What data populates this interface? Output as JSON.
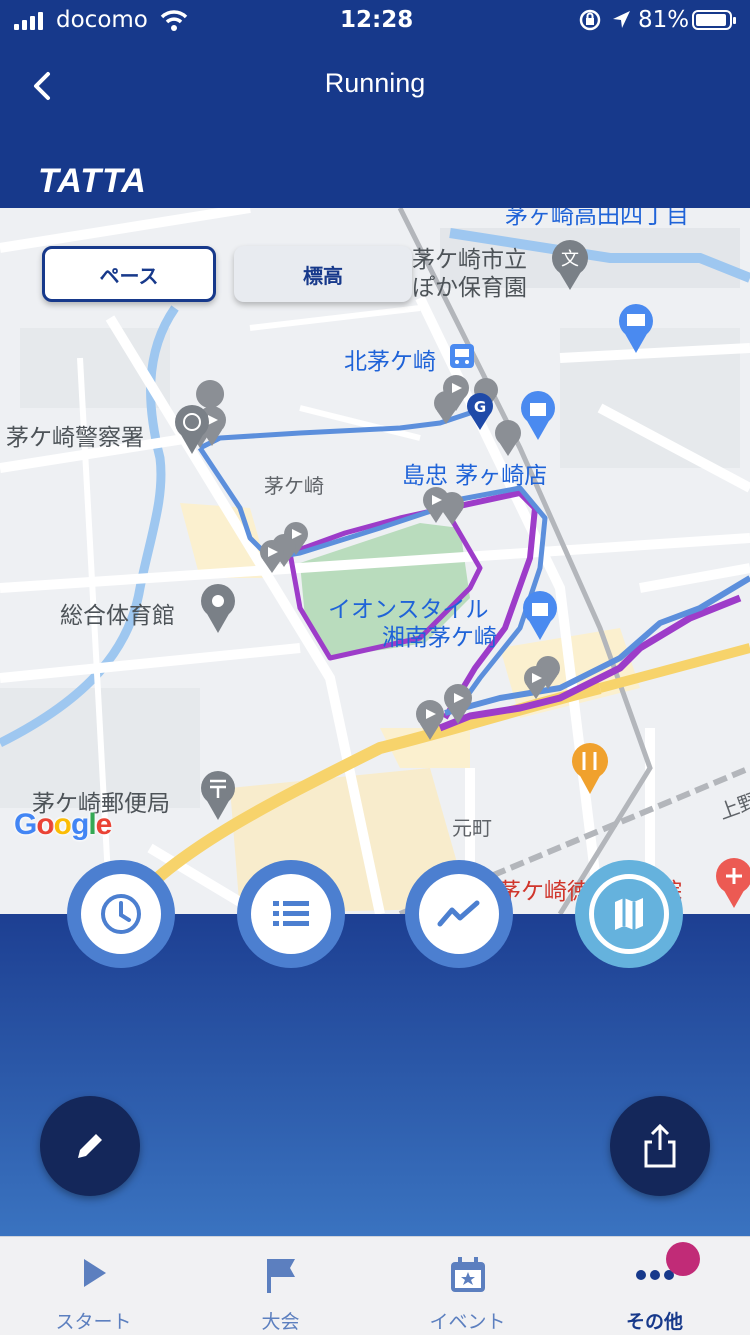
{
  "status_bar": {
    "carrier": "docomo",
    "time": "12:28",
    "battery": "81%"
  },
  "nav": {
    "title": "Running",
    "logo": "TATTA"
  },
  "map": {
    "toggle": {
      "pace": "ペース",
      "elevation": "標高"
    },
    "labels": {
      "nursery_line1": "茅ケ崎市立",
      "nursery_line2": "ぽか保育園",
      "station": "北茅ケ崎",
      "police": "茅ケ崎警察署",
      "district": "茅ケ崎",
      "shimachu": "島忠 茅ヶ崎店",
      "aeon_line1": "イオンスタイル",
      "aeon_line2": "湘南茅ケ崎",
      "gym": "総合体育館",
      "post_office": "茅ケ崎郵便局",
      "motomachi": "元町",
      "hospital": "茅ケ崎徳洲会病院",
      "ueno": "上野",
      "top_cut": "茅ヶ崎高田四丁目"
    },
    "attribution": "Google",
    "route_colors": {
      "pace_blue": "#5c8fdc",
      "pace_purple": "#9d3cc9"
    },
    "icons": [
      "school-icon",
      "train-icon",
      "police-icon",
      "shopping-icon",
      "pin-icon",
      "post-icon",
      "restaurant-icon",
      "hospital-icon",
      "goal-marker-icon"
    ]
  },
  "view_buttons": [
    "clock-icon",
    "list-icon",
    "chart-icon",
    "map-icon"
  ],
  "selected_view": "map-icon",
  "tabs": [
    {
      "label": "スタート",
      "icon": "play-icon"
    },
    {
      "label": "大会",
      "icon": "flag-icon"
    },
    {
      "label": "イベント",
      "icon": "calendar-icon"
    },
    {
      "label": "その他",
      "icon": "more-icon"
    }
  ],
  "active_tab": "その他",
  "colors": {
    "brand": "#17398b",
    "badge": "#c12b77",
    "accent": "#65b2dd"
  }
}
